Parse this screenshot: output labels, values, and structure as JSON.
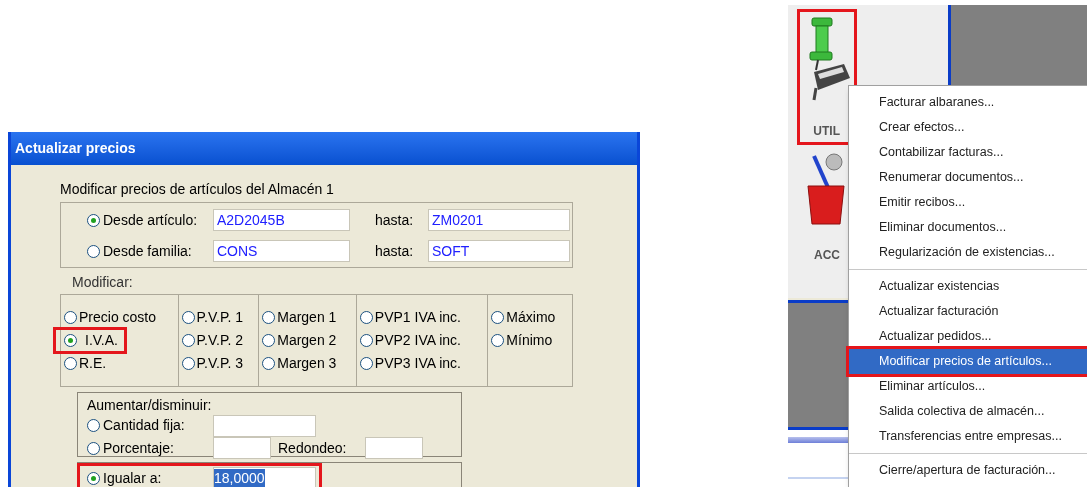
{
  "dialog": {
    "title": "Actualizar precios",
    "heading": "Modificar precios de artículos del Almacén 1",
    "range_rows": [
      {
        "label": "Desde artículo:",
        "selected": true,
        "from": "A2D2045B",
        "to_label": "hasta:",
        "to": "ZM0201"
      },
      {
        "label": "Desde familia:",
        "selected": false,
        "from": "CONS",
        "to_label": "hasta:",
        "to": "SOFT"
      }
    ],
    "modify_label": "Modificar:",
    "modify_columns": [
      [
        {
          "label": "Precio costo",
          "selected": false,
          "highlighted": false
        },
        {
          "label": "I.V.A.",
          "selected": true,
          "highlighted": true
        },
        {
          "label": "R.E.",
          "selected": false,
          "highlighted": false
        }
      ],
      [
        {
          "label": "P.V.P. 1",
          "selected": false,
          "highlighted": false
        },
        {
          "label": "P.V.P. 2",
          "selected": false,
          "highlighted": false
        },
        {
          "label": "P.V.P. 3",
          "selected": false,
          "highlighted": false
        }
      ],
      [
        {
          "label": "Margen 1",
          "selected": false,
          "highlighted": false
        },
        {
          "label": "Margen 2",
          "selected": false,
          "highlighted": false
        },
        {
          "label": "Margen 3",
          "selected": false,
          "highlighted": false
        }
      ],
      [
        {
          "label": "PVP1 IVA inc.",
          "selected": false,
          "highlighted": false
        },
        {
          "label": "PVP2 IVA inc.",
          "selected": false,
          "highlighted": false
        },
        {
          "label": "PVP3 IVA inc.",
          "selected": false,
          "highlighted": false
        }
      ],
      [
        {
          "label": "Máximo",
          "selected": false,
          "highlighted": false
        },
        {
          "label": "Mínimo",
          "selected": false,
          "highlighted": false
        }
      ]
    ],
    "adjust": {
      "title": "Aumentar/disminuir:",
      "fixed": {
        "label": "Cantidad fija:",
        "selected": false
      },
      "percent": {
        "label": "Porcentaje:",
        "selected": false
      },
      "rounding_label": "Redondeo:"
    },
    "equal": {
      "label": "Igualar a:",
      "selected": true,
      "highlighted": true,
      "value": "18,0000"
    }
  },
  "toolbar": [
    {
      "label": "UTIL",
      "kind": "pin",
      "highlighted": true
    },
    {
      "label": "ACC",
      "kind": "cup",
      "highlighted": false
    }
  ],
  "menu": [
    {
      "kind": "item",
      "label": "Facturar albaranes...",
      "selected": false,
      "highlighted": false
    },
    {
      "kind": "item",
      "label": "Crear efectos...",
      "selected": false,
      "highlighted": false
    },
    {
      "kind": "item",
      "label": "Contabilizar facturas...",
      "selected": false,
      "highlighted": false
    },
    {
      "kind": "item",
      "label": "Renumerar documentos...",
      "selected": false,
      "highlighted": false
    },
    {
      "kind": "item",
      "label": "Emitir recibos...",
      "selected": false,
      "highlighted": false
    },
    {
      "kind": "item",
      "label": "Eliminar documentos...",
      "selected": false,
      "highlighted": false
    },
    {
      "kind": "item",
      "label": "Regularización de existencias...",
      "selected": false,
      "highlighted": false
    },
    {
      "kind": "separator"
    },
    {
      "kind": "item",
      "label": "Actualizar existencias",
      "selected": false,
      "highlighted": false
    },
    {
      "kind": "item",
      "label": "Actualizar facturación",
      "selected": false,
      "highlighted": false
    },
    {
      "kind": "item",
      "label": "Actualizar pedidos...",
      "selected": false,
      "highlighted": false
    },
    {
      "kind": "item",
      "label": "Modificar precios de artículos...",
      "selected": true,
      "highlighted": true
    },
    {
      "kind": "item",
      "label": "Eliminar artículos...",
      "selected": false,
      "highlighted": false
    },
    {
      "kind": "item",
      "label": "Salida colectiva de almacén...",
      "selected": false,
      "highlighted": false
    },
    {
      "kind": "item",
      "label": "Transferencias entre empresas...",
      "selected": false,
      "highlighted": false
    },
    {
      "kind": "separator"
    },
    {
      "kind": "item",
      "label": "Cierre/apertura de facturación...",
      "selected": false,
      "highlighted": false
    }
  ]
}
